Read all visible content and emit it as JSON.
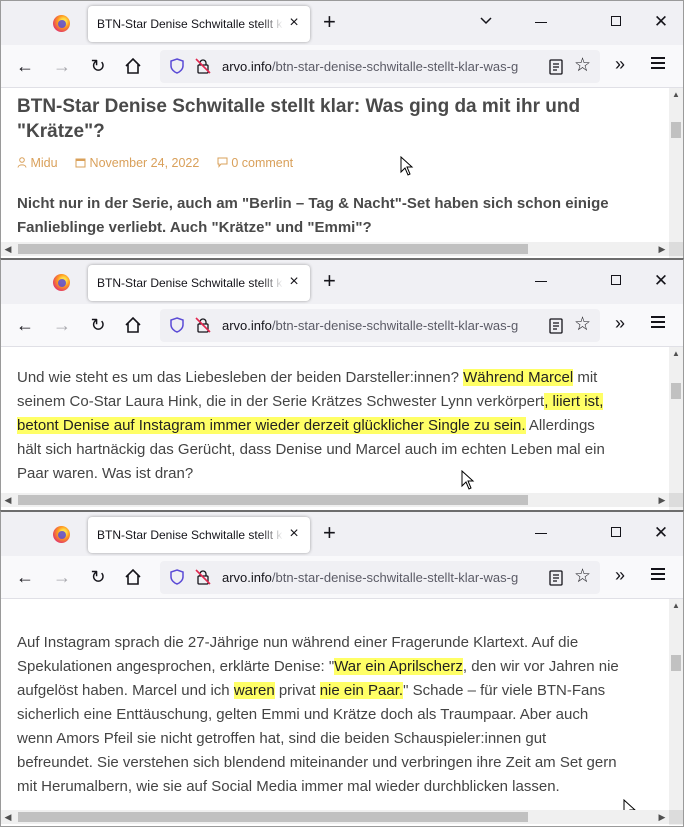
{
  "browser": {
    "tab_title": "BTN-Star Denise Schwitalle stellt klar: Was ging da mit ihr und \"Krätze\"?",
    "tab_title_visible": "BTN-Star Denise Schwitalle stellt klar",
    "url_host": "arvo.info",
    "url_path": "/btn-star-denise-schwitalle-stellt-klar-was-g",
    "new_tab_symbol": "+",
    "close_tab_symbol": "×",
    "icons": [
      "firefox-logo",
      "back-arrow",
      "forward-arrow",
      "reload",
      "home",
      "shield",
      "lock-strike",
      "reader-view",
      "bookmark-star",
      "overflow-chevrons",
      "hamburger-menu"
    ]
  },
  "window1": {
    "headline_line1": "BTN-Star Denise Schwitalle stellt klar: Was ging da mit ihr und",
    "headline_line2": "\"Krätze\"?",
    "author": "Midu",
    "date": "November 24, 2022",
    "comments": "0 comment",
    "lead_line1": "Nicht nur in der Serie, auch am \"Berlin – Tag & Nacht\"-Set haben sich schon einige",
    "lead_line2": "Fanlieblinge verliebt. Auch \"Krätze\" und \"Emmi\"?"
  },
  "window2": {
    "l1_a": "Und wie steht es um das Liebesleben der beiden Darsteller:innen? ",
    "l1_hl": "Während Marcel",
    "l1_b": " mit",
    "l2_a": "seinem Co-Star Laura Hink, die in der Serie Krätzes Schwester Lynn verkörpert",
    "l2_hl": ", liiert ist,",
    "l3_hl": "betont Denise auf Instagram immer wieder derzeit glücklicher Single zu sein.",
    "l3_b": " Allerdings",
    "l4": "hält sich hartnäckig das Gerücht, dass Denise und Marcel auch im echten Leben mal ein",
    "l5": "Paar waren. Was ist dran?"
  },
  "window3": {
    "l1": "Auf Instagram sprach die 27-Jährige nun während einer Fragerunde Klartext. Auf die",
    "l2_a": "Spekulationen angesprochen, erklärte Denise: \"",
    "l2_hl": "War ein Aprilscherz",
    "l2_b": ", den wir vor Jahren nie",
    "l3_a": "aufgelöst haben. Marcel und ich ",
    "l3_hl1": "waren",
    "l3_b": " privat ",
    "l3_hl2": "nie ein Paar.",
    "l3_c": "\" Schade – für viele BTN-Fans",
    "l4": "sicherlich eine Enttäuschung, gelten Emmi und Krätze doch als Traumpaar. Aber auch",
    "l5": "wenn Amors Pfeil sie nicht getroffen hat, sind die beiden Schauspieler:innen gut",
    "l6": "befreundet. Sie verstehen sich blendend miteinander und verbringen ihre Zeit am Set gern",
    "l7": "mit Herumalbern, wie sie auf Social Media immer mal wieder durchblicken lassen."
  },
  "colors": {
    "highlight": "#ffff66",
    "meta": "#d9a05a",
    "text": "#444444"
  }
}
